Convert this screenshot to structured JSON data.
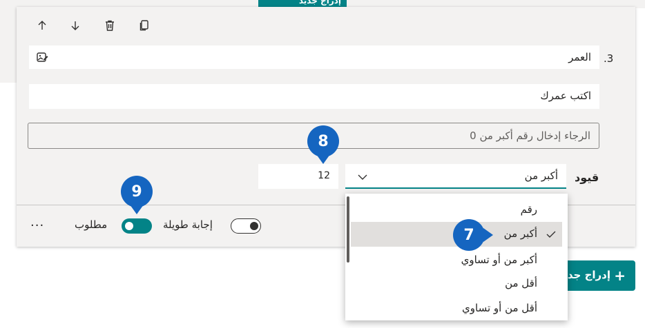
{
  "background": {
    "top_insert_label": "إدراج جديد",
    "insert_button_label": "إدراج جديد",
    "insert_plus": "+"
  },
  "toolbar": {
    "move_up_icon": "arrow-up-icon",
    "move_down_icon": "arrow-down-icon",
    "delete_icon": "trash-icon",
    "copy_icon": "copy-icon"
  },
  "question": {
    "number": "3.",
    "title": "العمر",
    "answer_placeholder": "اكتب عمرك",
    "error_message": "الرجاء إدخال رقم أكبر من 0"
  },
  "restrictions": {
    "label": "قيود",
    "selected": "أكبر من",
    "value": "12",
    "options": [
      "رقم",
      "أكبر من",
      "أكبر من أو تساوي",
      "أقل من",
      "أقل من أو تساوي"
    ],
    "selected_index": 1
  },
  "footer": {
    "long_answer_label": "إجابة طويلة",
    "long_answer_on": false,
    "required_label": "مطلوب",
    "required_on": true,
    "more_label": "..."
  },
  "callouts": {
    "c7": "7",
    "c8": "8",
    "c9": "9"
  },
  "colors": {
    "accent": "#038387",
    "callout": "#1565c0"
  }
}
